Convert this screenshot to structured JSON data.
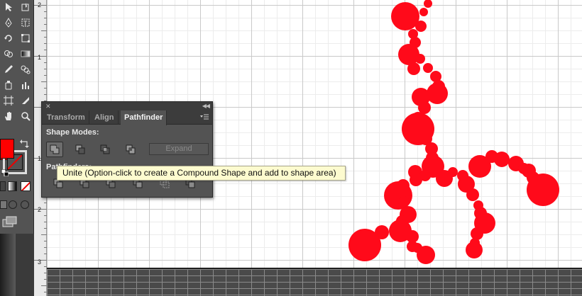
{
  "pathfinder_panel": {
    "tabs": [
      {
        "label": "Transform",
        "active": false
      },
      {
        "label": "Align",
        "active": false
      },
      {
        "label": "Pathfinder",
        "active": true
      }
    ],
    "shape_modes_label": "Shape Modes:",
    "pathfinders_label": "Pathfinders:",
    "shape_mode_buttons": [
      "unite-icon",
      "minus-front-icon",
      "intersect-icon",
      "exclude-icon"
    ],
    "expand_label": "Expand",
    "expand_enabled": false,
    "pathfinder_buttons": [
      "divide-icon",
      "trim-icon",
      "merge-icon",
      "crop-icon",
      "outline-icon",
      "minus-back-icon"
    ]
  },
  "tooltip": {
    "text": "Unite (Option-click to create a Compound Shape and add to shape area)"
  },
  "vertical_ruler": {
    "labels": [
      "2",
      "1",
      "1",
      "2",
      "3"
    ]
  },
  "toolbar": {
    "fill_color": "#ff0000",
    "stroke": "none"
  },
  "colors": {
    "artwork": "#ff0a1a",
    "tooltip_background": "#fdfbcf",
    "panel_background": "#535353"
  }
}
